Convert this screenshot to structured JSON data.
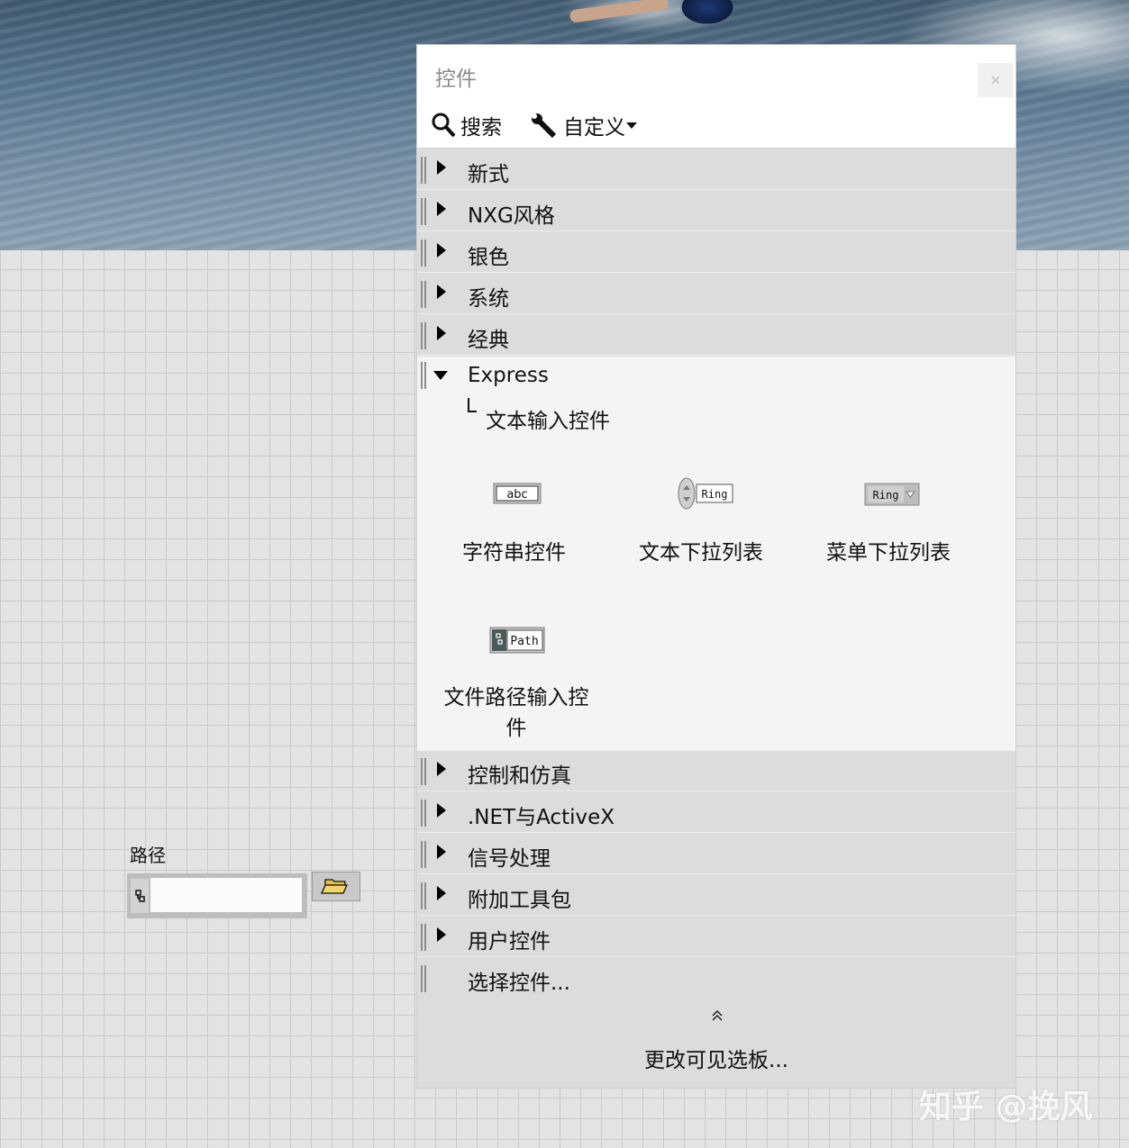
{
  "palette": {
    "title": "控件",
    "close_label": "×",
    "toolbar": {
      "search_label": "搜索",
      "customize_label": "自定义"
    },
    "categories_top": [
      {
        "label": "新式"
      },
      {
        "label": "NXG风格"
      },
      {
        "label": "银色"
      },
      {
        "label": "系统"
      },
      {
        "label": "经典"
      }
    ],
    "express": {
      "label": "Express",
      "subcategory": "文本输入控件",
      "controls": [
        {
          "label": "字符串控件",
          "icon_text": "abc"
        },
        {
          "label": "文本下拉列表",
          "icon_text": "Ring"
        },
        {
          "label": "菜单下拉列表",
          "icon_text": "Ring"
        },
        {
          "label_line1": "文件路径输入控",
          "label_line2": "件",
          "icon_text": "Path"
        }
      ]
    },
    "categories_bottom": [
      {
        "label": "控制和仿真"
      },
      {
        "label": ".NET与ActiveX"
      },
      {
        "label": "信号处理"
      },
      {
        "label": "附加工具包"
      },
      {
        "label": "用户控件"
      }
    ],
    "select_control": "选择控件...",
    "collapse_icon": "double-chevron-up-icon",
    "change_visible": "更改可见选板..."
  },
  "front_panel": {
    "path_label": "路径",
    "path_value": ""
  },
  "watermark": "知乎 @挽风"
}
